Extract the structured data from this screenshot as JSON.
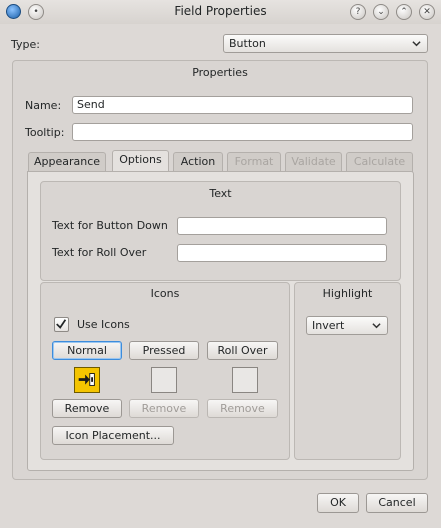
{
  "window": {
    "title": "Field Properties",
    "buttons": [
      "?",
      "⌄",
      "⌃",
      "✕"
    ]
  },
  "type_row": {
    "label": "Type:",
    "value": "Button"
  },
  "properties": {
    "title": "Properties",
    "name_label": "Name:",
    "name_value": "Send",
    "tooltip_label": "Tooltip:",
    "tooltip_value": ""
  },
  "tabs": [
    {
      "label": "Appearance",
      "state": "normal"
    },
    {
      "label": "Options",
      "state": "active"
    },
    {
      "label": "Action",
      "state": "normal"
    },
    {
      "label": "Format",
      "state": "disabled"
    },
    {
      "label": "Validate",
      "state": "disabled"
    },
    {
      "label": "Calculate",
      "state": "disabled"
    }
  ],
  "text_section": {
    "title": "Text",
    "button_down_label": "Text for Button Down",
    "button_down_value": "",
    "roll_over_label": "Text for Roll Over",
    "roll_over_value": ""
  },
  "icons_section": {
    "title": "Icons",
    "use_icons_label": "Use Icons",
    "use_icons_checked": true,
    "normal_label": "Normal",
    "pressed_label": "Pressed",
    "rollover_label": "Roll Over",
    "remove_label": "Remove",
    "placement_label": "Icon Placement..."
  },
  "highlight_section": {
    "title": "Highlight",
    "value": "Invert"
  },
  "footer": {
    "ok_label": "OK",
    "cancel_label": "Cancel"
  },
  "colors": {
    "accent": "#3c8cdc",
    "icon_yellow": "#f4c400",
    "window_bg": "#ddd9d6"
  }
}
